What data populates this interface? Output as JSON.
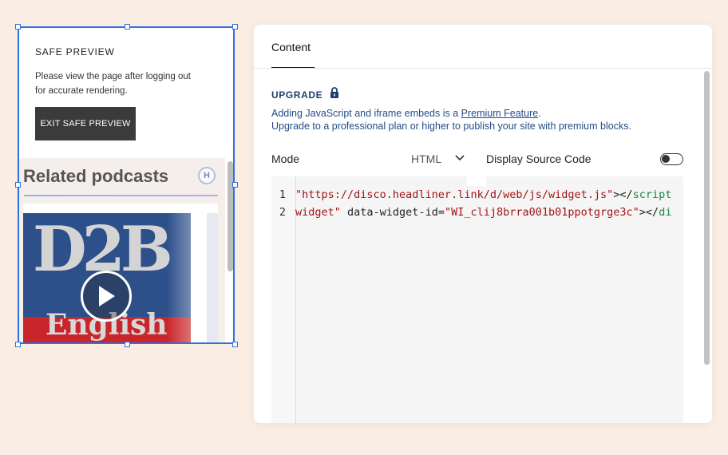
{
  "preview": {
    "safe_title": "SAFE PREVIEW",
    "safe_text": "Please view the page after logging out for accurate rendering.",
    "exit_button": "EXIT SAFE PREVIEW",
    "related_title": "Related podcasts",
    "logo_letter": "H",
    "cover": {
      "top_text": "D2B",
      "bottom_text": "English"
    }
  },
  "panel": {
    "tab": "Content",
    "upgrade": {
      "label": "UPGRADE",
      "line1_prefix": "Adding JavaScript and iframe embeds is a ",
      "line1_link": "Premium Feature",
      "line1_suffix": ".",
      "line2": "Upgrade to a professional plan or higher to publish your site with premium blocks."
    },
    "mode": {
      "label": "Mode",
      "value": "HTML"
    },
    "display_source": {
      "label": "Display Source Code",
      "enabled": false
    },
    "code": {
      "line_numbers": [
        "1",
        "2"
      ],
      "line1": {
        "str": "\"https://disco.headliner.link/d/web/js/widget.js\"",
        "punct": "></",
        "tag": "script"
      },
      "line2": {
        "str1": "widget\"",
        "attr": " data-widget-id=",
        "str2": "\"WI_clij8brra001b01ppotgrge3c\"",
        "punct": "></",
        "tag": "di"
      }
    }
  },
  "icons": {
    "lock": "lock-icon",
    "chevron": "chevron-down-icon",
    "play": "play-icon"
  },
  "colors": {
    "selection": "#2f6fe4",
    "link_text": "#244c86",
    "code_string": "#a31515",
    "code_tag": "#1a8a3a",
    "background": "#faeee4"
  }
}
